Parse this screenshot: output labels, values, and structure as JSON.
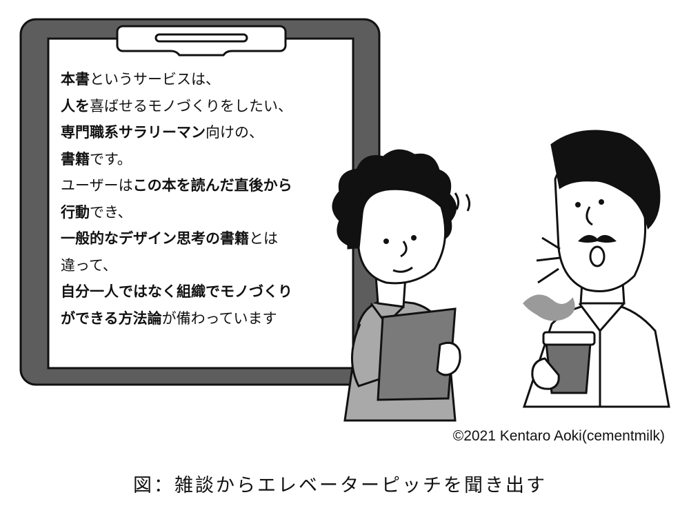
{
  "board": {
    "lines": [
      [
        {
          "t": "本書",
          "b": true
        },
        {
          "t": "というサービスは、",
          "b": false
        }
      ],
      [
        {
          "t": "人を",
          "b": true
        },
        {
          "t": "喜ばせるモノづくりをしたい、",
          "b": false
        }
      ],
      [
        {
          "t": "専門職系サラリーマン",
          "b": true
        },
        {
          "t": "向けの、",
          "b": false
        }
      ],
      [
        {
          "t": "書籍",
          "b": true
        },
        {
          "t": "です。",
          "b": false
        }
      ],
      [
        {
          "t": "ユーザーは",
          "b": false
        },
        {
          "t": "この本を読んだ直後から",
          "b": true
        }
      ],
      [
        {
          "t": "行動",
          "b": true
        },
        {
          "t": "でき、",
          "b": false
        }
      ],
      [
        {
          "t": "一般的なデザイン思考の書籍",
          "b": true
        },
        {
          "t": "とは",
          "b": false
        }
      ],
      [
        {
          "t": "違って、",
          "b": false
        }
      ],
      [
        {
          "t": "自分一人ではなく組織でモノづくり",
          "b": true
        }
      ],
      [
        {
          "t": "ができる方法論",
          "b": true
        },
        {
          "t": "が備わっています",
          "b": false
        }
      ]
    ]
  },
  "credit": "©2021 Kentaro Aoki(cementmilk)",
  "caption": "図：雑談からエレベーターピッチを聞き出す",
  "colors": {
    "board_frame": "#5d5d5d",
    "paper": "#ffffff",
    "outline": "#111111",
    "shirt_gray": "#a9a9a9",
    "clipboard_gray": "#7a7a7a",
    "cup_gray": "#6f6f6f",
    "steam_gray": "#9a9a9a"
  }
}
